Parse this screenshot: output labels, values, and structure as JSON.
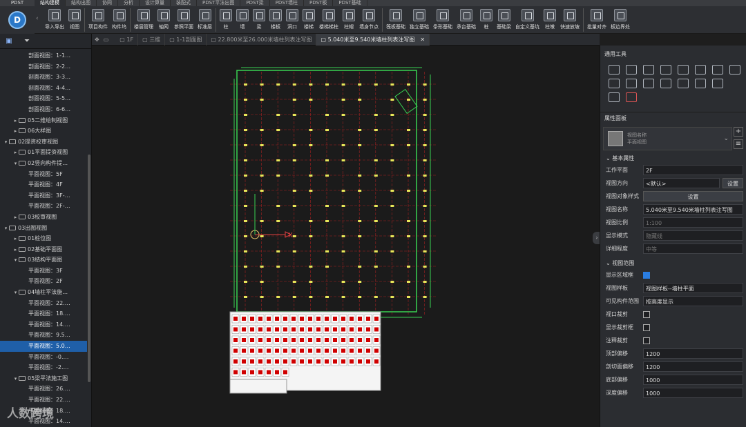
{
  "app": {
    "name": "PDST",
    "logo_letter": "D"
  },
  "ribbon_tabs": [
    "结构建模",
    "结构出图",
    "协同",
    "分析",
    "设计算量",
    "装配式",
    "PDST平法出图",
    "PDST梁",
    "PDST墙柱",
    "PDST板",
    "PDST基础"
  ],
  "toolbar": [
    {
      "group": "io",
      "items": [
        "导入导出",
        "视图"
      ]
    },
    {
      "group": "proj",
      "items": [
        "项目构件",
        "构件坞"
      ]
    },
    {
      "group": "floor",
      "items": [
        "楼层管理",
        "轴网",
        "参照平面",
        "标准层"
      ]
    },
    {
      "group": "struct",
      "items": [
        "柱",
        "墙",
        "梁",
        "楼板",
        "洞口",
        "楼梯",
        "楼梯梯柱",
        "柱帽",
        "墙身节点"
      ]
    },
    {
      "group": "found",
      "items": [
        "筏板基础",
        "独立基础",
        "条形基础",
        "承台基础",
        "桩",
        "基础梁",
        "自定义基坑",
        "柱墩",
        "快速放坡"
      ]
    },
    {
      "group": "edit",
      "items": [
        "批量对齐",
        "板边界处"
      ]
    }
  ],
  "left_panel": {
    "tree": [
      {
        "level": 3,
        "label": "剖面视图：1-1…"
      },
      {
        "level": 3,
        "label": "剖面视图：2-2…"
      },
      {
        "level": 3,
        "label": "剖面视图：3-3…"
      },
      {
        "level": 3,
        "label": "剖面视图：4-4…"
      },
      {
        "level": 3,
        "label": "剖面视图：5-5…"
      },
      {
        "level": 3,
        "label": "剖面视图：6-6…"
      },
      {
        "level": 2,
        "label": "05二维绘制视图",
        "folder": true
      },
      {
        "level": 2,
        "label": "06大样图",
        "folder": true
      },
      {
        "level": 1,
        "label": "02提资校审视图",
        "folder": true,
        "open": true
      },
      {
        "level": 2,
        "label": "01平面提资视图",
        "folder": true
      },
      {
        "level": 2,
        "label": "02竖向构件提…",
        "folder": true,
        "open": true
      },
      {
        "level": 3,
        "label": "平面视图：5F"
      },
      {
        "level": 3,
        "label": "平面视图：4F"
      },
      {
        "level": 3,
        "label": "平面视图：3F-…"
      },
      {
        "level": 3,
        "label": "平面视图：2F-…"
      },
      {
        "level": 2,
        "label": "03校审视图",
        "folder": true
      },
      {
        "level": 1,
        "label": "03出图视图",
        "folder": true,
        "open": true
      },
      {
        "level": 2,
        "label": "01桩位图",
        "folder": true
      },
      {
        "level": 2,
        "label": "02基础平面图",
        "folder": true
      },
      {
        "level": 2,
        "label": "03结构平面图",
        "folder": true,
        "open": true
      },
      {
        "level": 3,
        "label": "平面视图：3F"
      },
      {
        "level": 3,
        "label": "平面视图：2F"
      },
      {
        "level": 2,
        "label": "04墙柱平法施…",
        "folder": true,
        "open": true
      },
      {
        "level": 3,
        "label": "平面视图：22.…"
      },
      {
        "level": 3,
        "label": "平面视图：18.…"
      },
      {
        "level": 3,
        "label": "平面视图：14.…"
      },
      {
        "level": 3,
        "label": "平面视图：9.5…"
      },
      {
        "level": 3,
        "label": "平面视图：5.0…",
        "selected": true
      },
      {
        "level": 3,
        "label": "平面视图：-0.…"
      },
      {
        "level": 3,
        "label": "平面视图：-2.…"
      },
      {
        "level": 2,
        "label": "05梁平法施工图",
        "folder": true,
        "open": true
      },
      {
        "level": 3,
        "label": "平面视图：26.…"
      },
      {
        "level": 3,
        "label": "平面视图：22.…"
      },
      {
        "level": 3,
        "label": "平面视图：18.…"
      },
      {
        "level": 3,
        "label": "平面视图：14.…"
      }
    ]
  },
  "view_tabs": [
    {
      "label": "1F",
      "active": false
    },
    {
      "label": "三维",
      "active": false
    },
    {
      "label": "1-1剖面图",
      "active": false
    },
    {
      "label": "22.800米至26.000米墙柱列表注写图",
      "active": false
    },
    {
      "label": "5.040米至9.540米墙柱列表注写图",
      "active": true
    }
  ],
  "canvas": {
    "axis_x_label": "X",
    "axis_y_label": "Y"
  },
  "right_panel": {
    "common_tools_title": "通用工具",
    "properties_title": "属性面板",
    "type_name": "视图名称",
    "type_sub": "平面视图",
    "basic_group": "基本属性",
    "rows": [
      {
        "key": "工作平面",
        "value": "2F",
        "kind": "select"
      },
      {
        "key": "视图方向",
        "value": "<默认>",
        "kind": "select",
        "button": "设置"
      },
      {
        "key": "视图对象样式",
        "value": "设置",
        "kind": "button"
      },
      {
        "key": "视图名称",
        "value": "5.040米至9.540米墙柱列表注写图",
        "kind": "text"
      },
      {
        "key": "视图比例",
        "value": "1:100",
        "kind": "disabled"
      },
      {
        "key": "显示模式",
        "value": "隐藏线",
        "kind": "disabled"
      },
      {
        "key": "详细程度",
        "value": "中等",
        "kind": "disabled"
      }
    ],
    "range_group": "视图范围",
    "range_rows": [
      {
        "key": "显示区域框",
        "checked": true,
        "kind": "check"
      },
      {
        "key": "视图样板",
        "value": "视图样板--墙柱平面",
        "kind": "select"
      },
      {
        "key": "可见构件范围",
        "value": "按高度显示",
        "kind": "select"
      },
      {
        "key": "视口裁剪",
        "checked": false,
        "kind": "check"
      },
      {
        "key": "显示裁剪框",
        "checked": false,
        "kind": "check"
      },
      {
        "key": "注释裁剪",
        "checked": false,
        "kind": "check"
      },
      {
        "key": "顶部偏移",
        "value": "1200",
        "kind": "text"
      },
      {
        "key": "剖切面偏移",
        "value": "1200",
        "kind": "text"
      },
      {
        "key": "底部偏移",
        "value": "1000",
        "kind": "text"
      },
      {
        "key": "深度偏移",
        "value": "1000",
        "kind": "text"
      }
    ]
  },
  "watermark": "人数跨境",
  "colors": {
    "accent": "#2a7de1",
    "grid_red": "#c82828",
    "wall_green": "#39d353",
    "selected": "#1f5fa8"
  }
}
